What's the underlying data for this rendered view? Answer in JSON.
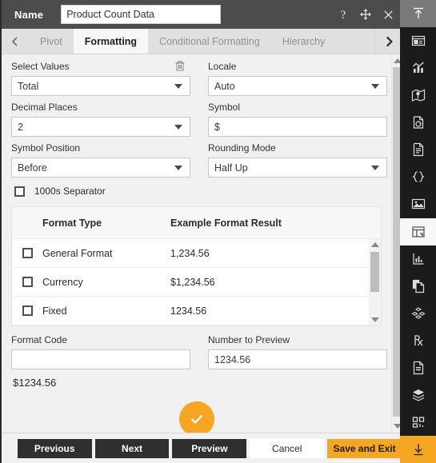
{
  "titlebar": {
    "label": "Name",
    "name_value": "Product Count Data",
    "name_placeholder": "Name",
    "icons": [
      "help-icon",
      "move-icon",
      "close-icon"
    ]
  },
  "tabs": {
    "prev_arrow": "chevron-left-icon",
    "next_arrow": "chevron-right-icon",
    "items": [
      {
        "label": "Pivot",
        "active": false
      },
      {
        "label": "Formatting",
        "active": true
      },
      {
        "label": "Conditional Formatting",
        "active": false
      },
      {
        "label": "Hierarchy",
        "active": false
      }
    ]
  },
  "form": {
    "select_values": {
      "label": "Select Values",
      "value": "Total"
    },
    "locale": {
      "label": "Locale",
      "value": "Auto"
    },
    "decimal_places": {
      "label": "Decimal Places",
      "value": "2"
    },
    "symbol": {
      "label": "Symbol",
      "value": "$"
    },
    "symbol_position": {
      "label": "Symbol Position",
      "value": "Before"
    },
    "rounding_mode": {
      "label": "Rounding Mode",
      "value": "Half Up"
    },
    "thousands_separator": {
      "label": "1000s Separator",
      "checked": false
    },
    "delete_icon": "trash-icon"
  },
  "table": {
    "headers": [
      "Format Type",
      "Example Format Result"
    ],
    "rows": [
      {
        "checked": false,
        "type": "General Format",
        "example": "1,234.56"
      },
      {
        "checked": false,
        "type": "Currency",
        "example": "$1,234.56"
      },
      {
        "checked": false,
        "type": "Fixed",
        "example": "1234.56"
      }
    ]
  },
  "bottom": {
    "format_code": {
      "label": "Format Code",
      "value": ""
    },
    "number_to_preview": {
      "label": "Number to Preview",
      "value": "1234.56"
    },
    "preview_result": "$1234.56",
    "apply_icon": "check-icon"
  },
  "footer": {
    "buttons": [
      {
        "label": "Previous",
        "style": "dark"
      },
      {
        "label": "Next",
        "style": "dark"
      },
      {
        "label": "Preview",
        "style": "dark"
      },
      {
        "label": "Cancel",
        "style": "light"
      },
      {
        "label": "Save and Exit",
        "style": "orange"
      }
    ]
  },
  "rail": {
    "items": [
      {
        "name": "collapse-up-icon",
        "state": "top-active"
      },
      {
        "name": "dashboard-icon",
        "state": "normal"
      },
      {
        "name": "chart-icon",
        "state": "normal"
      },
      {
        "name": "map-icon",
        "state": "normal"
      },
      {
        "name": "document-refresh-icon",
        "state": "normal"
      },
      {
        "name": "text-document-icon",
        "state": "normal"
      },
      {
        "name": "code-braces-icon",
        "state": "normal"
      },
      {
        "name": "image-icon",
        "state": "normal"
      },
      {
        "name": "pivot-table-icon",
        "state": "sel"
      },
      {
        "name": "sparkline-icon",
        "state": "normal"
      },
      {
        "name": "copy-document-icon",
        "state": "normal"
      },
      {
        "name": "cubes-icon",
        "state": "normal"
      },
      {
        "name": "prescription-icon",
        "state": "normal"
      },
      {
        "name": "report-icon",
        "state": "normal"
      },
      {
        "name": "layers-icon",
        "state": "normal"
      },
      {
        "name": "widgets-icon",
        "state": "normal"
      },
      {
        "name": "download-icon",
        "state": "dl"
      }
    ]
  },
  "colors": {
    "accent_orange": "#f5a623",
    "titlebar_bg": "#4c4c4c",
    "rail_bg": "#1b1b1b",
    "panel_bg": "#f1f1f1"
  }
}
